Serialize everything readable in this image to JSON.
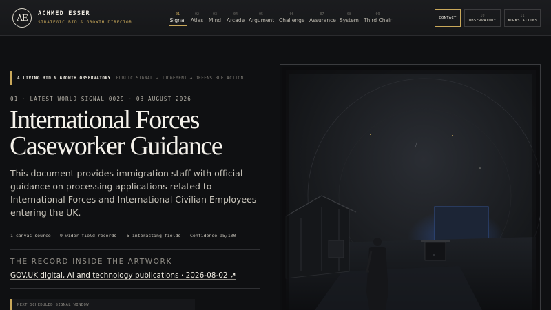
{
  "brand": {
    "logo_text": "AE",
    "name": "ACHMED ESSER",
    "role": "STRATEGIC BID & GROWTH DIRECTOR"
  },
  "nav": [
    {
      "num": "01",
      "label": "Signal"
    },
    {
      "num": "02",
      "label": "Atlas"
    },
    {
      "num": "03",
      "label": "Mind"
    },
    {
      "num": "04",
      "label": "Arcade"
    },
    {
      "num": "05",
      "label": "Argument"
    },
    {
      "num": "06",
      "label": "Challenge"
    },
    {
      "num": "07",
      "label": "Assurance"
    },
    {
      "num": "08",
      "label": "System"
    },
    {
      "num": "09",
      "label": "Third Chair"
    }
  ],
  "header_buttons": {
    "contact": "CONTACT",
    "observatory": {
      "num": "10",
      "label": "OBSERVATORY"
    },
    "workstations": {
      "num": "11",
      "label": "WORKSTATIONS"
    }
  },
  "hero": {
    "eyebrow_strong": "A LIVING BID & GROWTH OBSERVATORY",
    "eyebrow_muted": "PUBLIC SIGNAL → JUDGEMENT → DEFENSIBLE ACTION",
    "kicker": "01 · LATEST WORLD SIGNAL 0029 · 03 AUGUST 2026",
    "title_line1": "International Forces",
    "title_line2": "Caseworker Guidance",
    "lede": "This document provides immigration staff with official guidance on processing applications related to International Forces and International Civilian Employees entering the UK.",
    "stats": [
      "1 canvas source",
      "9 wider-field records",
      "5 interacting fields",
      "Confidence 95/100"
    ],
    "record_title": "THE RECORD INSIDE THE ARTWORK",
    "record_link": "GOV.UK digital, AI and technology publications · 2026-08-02 ↗",
    "next_window": "NEXT SCHEDULED SIGNAL WINDOW"
  },
  "colors": {
    "accent": "#c9a85a",
    "background": "#0f1012",
    "text": "#f0ece2"
  }
}
